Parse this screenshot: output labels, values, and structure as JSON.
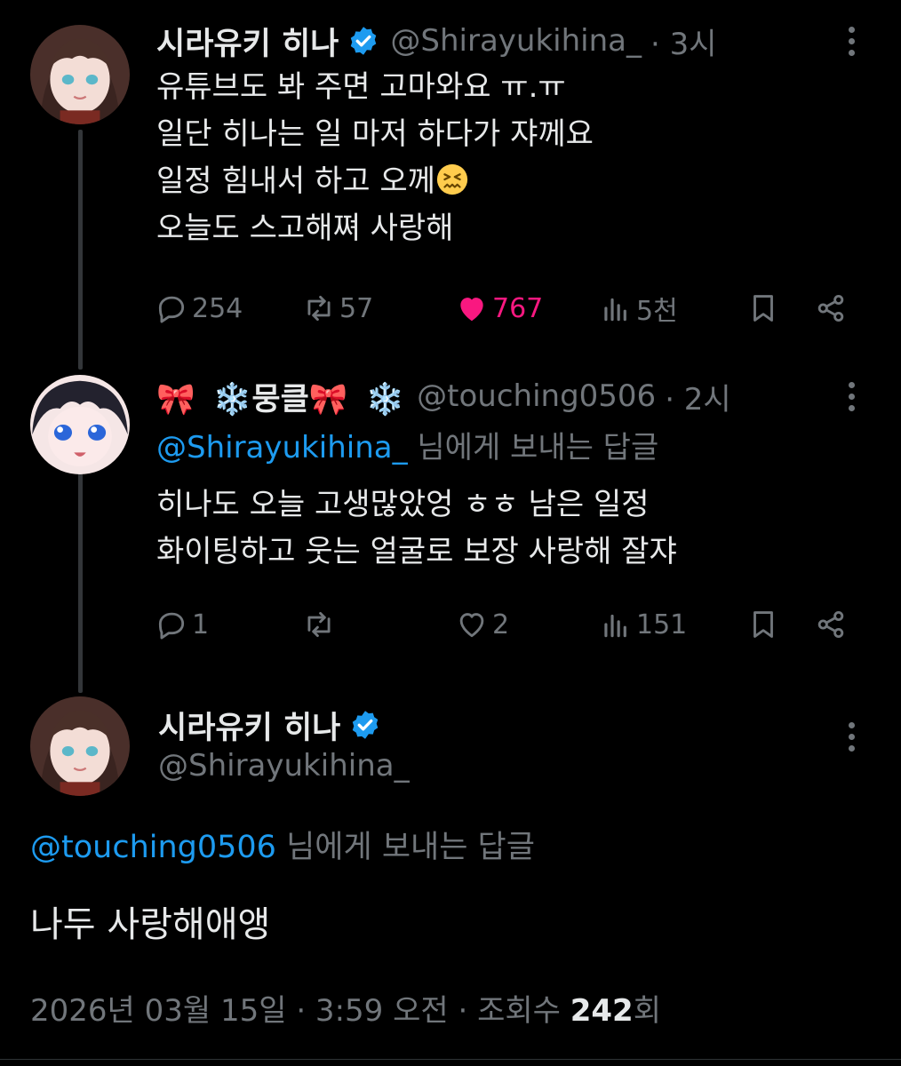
{
  "tweet1": {
    "display_name": "시라유키 히나",
    "handle": "@Shirayukihina_",
    "time": "· 3시",
    "lines": [
      "유튜브도 봐 주면 고마와요 ㅠ.ㅠ",
      "일단 히나는 일 마저 하다가 쟈께요",
      "일정 힘내서 하고 오께",
      "오늘도 스고해쪄 사랑해"
    ],
    "line3_emoji": "confounded-face-emoji",
    "stats": {
      "replies": "254",
      "reposts": "57",
      "likes": "767",
      "views": "5천"
    },
    "liked_color": "#f91880"
  },
  "tweet2": {
    "name_bow1": "🎀",
    "name_flake1": "❄️",
    "name_text": "뭉클",
    "name_bow2": "🎀",
    "name_flake2": "❄️",
    "handle": "@touching0506",
    "time": "· 2시",
    "reply_mention": "@Shirayukihina_",
    "reply_suffix": "님에게 보내는 답글",
    "lines": [
      "히나도 오늘 고생많았엉 ㅎㅎ 남은 일정",
      "화이팅하고 웃는 얼굴로 보장 사랑해 잘쟈"
    ],
    "stats": {
      "replies": "1",
      "reposts": "",
      "likes": "2",
      "views": "151"
    }
  },
  "focus": {
    "display_name": "시라유키 히나",
    "handle": "@Shirayukihina_",
    "reply_mention": "@touching0506",
    "reply_suffix": "님에게 보내는 답글",
    "text": "나두 사랑해애앵",
    "timestamp_prefix": "2026년 03월 15일 · 3:59 오전 · 조회수 ",
    "views_count": "242",
    "views_suffix": "회"
  },
  "colors": {
    "background": "#000000",
    "text": "#e7e9ea",
    "muted": "#71767b",
    "accent": "#1d9bf0",
    "like": "#f91880",
    "verified": "#1d9bf0"
  }
}
